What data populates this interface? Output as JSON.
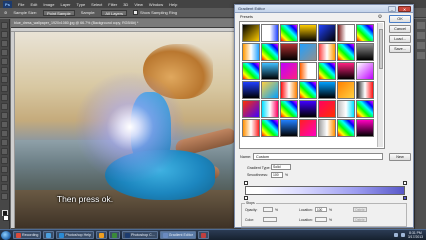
{
  "menubar": {
    "logo": "Ps",
    "items": [
      "File",
      "Edit",
      "Image",
      "Layer",
      "Type",
      "Select",
      "Filter",
      "3D",
      "View",
      "Window",
      "Help"
    ]
  },
  "options_bar": {
    "sample_size_label": "Sample Size:",
    "sample_size_value": "Point Sample",
    "sample_label": "Sample:",
    "sample_value": "All Layers",
    "show_sampling_ring": "Show Sampling Ring"
  },
  "document": {
    "tab_title": "blue_dress_wallpaper_1920x1080.jpg @ 66.7% (Background copy, RGB/8#) *",
    "caption": "Then press ok."
  },
  "gradient_editor": {
    "title": "Gradient Editor",
    "presets_label": "Presets",
    "gear_icon_glyph": "⚙",
    "buttons": {
      "ok": "OK",
      "cancel": "Cancel",
      "load": "Load...",
      "save": "Save..."
    },
    "name_label": "Name:",
    "name_value": "Custom",
    "new_button": "New",
    "gradient_type_label": "Gradient Type:",
    "gradient_type_value": "Solid",
    "smoothness_label": "Smoothness:",
    "smoothness_value": "100",
    "smoothness_unit": "%",
    "stops": {
      "title": "Stops",
      "opacity_label": "Opacity:",
      "opacity_unit": "%",
      "location_label": "Location:",
      "location_value": "100",
      "location_unit": "%",
      "delete_label": "Delete",
      "color_label": "Color:",
      "color_location_label": "Location:",
      "color_unit": "%",
      "color_delete_label": "Delete"
    },
    "presets": [
      [
        "#000000",
        "#ffffff",
        "#ff2020",
        "#ffcc00",
        "#2244ff",
        "#7a1a1a",
        "#ffe000"
      ],
      [
        "#ff9900",
        "#e0e0e0",
        "#b03030",
        "#20a0ff",
        "#ff4040",
        "#00c060",
        "#909090"
      ],
      [
        "#ffd000",
        "#40c0ff",
        "#c000ff",
        "#ff6000",
        "#00ffaa",
        "#ff2080",
        "#ffffff"
      ],
      [
        "#2040ff",
        "#ffd040",
        "#ff1010",
        "#d0d0d0",
        "#00a0ff",
        "#ff8000",
        "#202020"
      ],
      [
        "#ff3000",
        "#00e0ff",
        "#ffff00",
        "#4000ff",
        "#ff0060",
        "#c0c0c0",
        "#00b030"
      ],
      [
        "#ff9000",
        "#ffffff",
        "#2080ff",
        "#ff2020",
        "#a0a0a0",
        "#ffe000",
        "#ff00c0"
      ]
    ]
  },
  "taskbar": {
    "tasks": [
      {
        "label": "Recording",
        "color": "#d94a3a"
      },
      {
        "label": "",
        "color": "#4aa0e0"
      },
      {
        "label": "Photoshop Help",
        "color": "#2a8ad4"
      },
      {
        "label": "",
        "color": "#f0a020"
      },
      {
        "label": "",
        "color": "#3a8a3a"
      },
      {
        "label": "Photoshop C...",
        "color": "#1c3b6e"
      },
      {
        "label": "Gradient Editor",
        "color": "#6a8ac0"
      },
      {
        "label": "",
        "color": "#c04040"
      }
    ],
    "clock_time": "8:31 PM",
    "clock_date": "3/17/2013"
  }
}
